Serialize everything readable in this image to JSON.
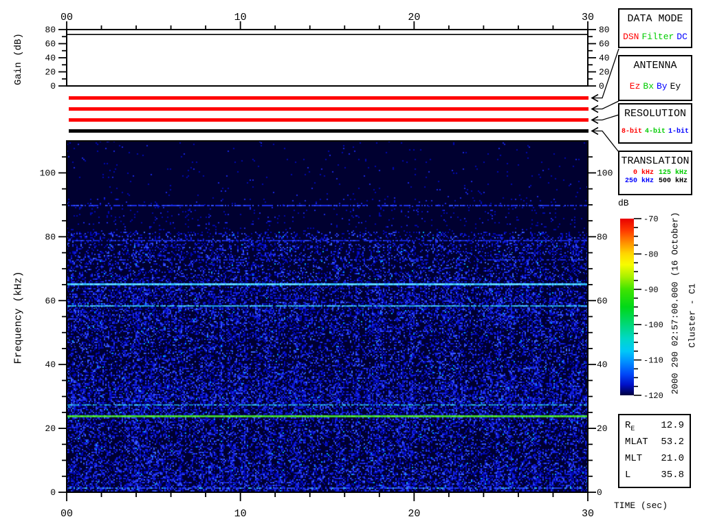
{
  "gain_plot": {
    "ylabel": "Gain (dB)",
    "ytick_labels": [
      "0",
      "20",
      "40",
      "60",
      "80"
    ],
    "ymax": 80,
    "gain_db": 73
  },
  "time_axis_top": {
    "labels": [
      "00",
      "10",
      "20",
      "30"
    ]
  },
  "time_axis_bottom": {
    "labels": [
      "00",
      "10",
      "20",
      "30"
    ],
    "title": "TIME (sec)"
  },
  "spectrogram": {
    "ylabel": "Frequency (kHz)",
    "ytick_labels": [
      "0",
      "20",
      "40",
      "60",
      "80",
      "100"
    ],
    "freq_max_khz": 110
  },
  "status_bars": [
    {
      "name": "data-mode",
      "color": "#ff0000",
      "value": "DSN"
    },
    {
      "name": "antenna",
      "color": "#ff0000",
      "value": "Ez"
    },
    {
      "name": "resolution",
      "color": "#ff0000",
      "value": "8-bit"
    },
    {
      "name": "translation",
      "color": "#000000",
      "value": "500 kHz"
    }
  ],
  "legend_boxes": [
    {
      "title": "DATA MODE",
      "items": [
        {
          "label": "DSN",
          "color": "#ff0000"
        },
        {
          "label": "Filter",
          "color": "#00cc00"
        },
        {
          "label": "DC",
          "color": "#0000ff"
        }
      ]
    },
    {
      "title": "ANTENNA",
      "items": [
        {
          "label": "Ez",
          "color": "#ff0000"
        },
        {
          "label": "Bx",
          "color": "#00cc00"
        },
        {
          "label": "By",
          "color": "#0000ff"
        },
        {
          "label": "Ey",
          "color": "#000000"
        }
      ]
    },
    {
      "title": "RESOLUTION",
      "items": [
        {
          "label": "8-bit",
          "color": "#ff0000"
        },
        {
          "label": "4-bit",
          "color": "#00cc00"
        },
        {
          "label": "1-bit",
          "color": "#0000ff"
        }
      ]
    },
    {
      "title": "TRANSLATION",
      "lines": [
        [
          {
            "label": "0 kHz",
            "color": "#ff0000"
          },
          {
            "label": "125 kHz",
            "color": "#00cc00"
          }
        ],
        [
          {
            "label": "250 kHz",
            "color": "#0000ff"
          },
          {
            "label": "500 kHz",
            "color": "#000000"
          }
        ]
      ]
    }
  ],
  "colorbar": {
    "label": "dB",
    "tick_labels": [
      "-70",
      "-80",
      "-90",
      "-100",
      "-110",
      "-120"
    ]
  },
  "side_annotations": {
    "timestamp": "2000 290 02:57:00.000  (16 October)",
    "spacecraft": "Cluster - C1"
  },
  "ephemeris": {
    "rows": [
      {
        "label": "R",
        "sub": "E",
        "value": "12.9"
      },
      {
        "label": "MLAT",
        "sub": "",
        "value": "53.2"
      },
      {
        "label": "MLT",
        "sub": "",
        "value": "21.0"
      },
      {
        "label": "L",
        "sub": "",
        "value": "35.8"
      }
    ]
  },
  "chart_data": [
    {
      "type": "heatmap",
      "title": "Cluster - C1 WBD spectrogram, 2000 290 02:57:00.000 (16 October)",
      "xlabel": "TIME (sec)",
      "ylabel": "Frequency (kHz)",
      "xlim": [
        0,
        30
      ],
      "ylim": [
        0,
        110
      ],
      "x_ticks": [
        0,
        10,
        20,
        30
      ],
      "x_minor_step_sec": 2,
      "y_ticks": [
        0,
        20,
        40,
        60,
        80,
        100
      ],
      "y_minor_step_khz": 5,
      "colorbar": {
        "label": "dB",
        "range_db": [
          -120,
          -70
        ],
        "ticks_db": [
          -70,
          -80,
          -90,
          -100,
          -110,
          -120
        ],
        "minor_step_db": 2.5
      },
      "background_level_db": {
        "above_80_khz": -119,
        "below_80_khz": -113
      },
      "spectral_lines": [
        {
          "freq_khz": 90,
          "approx_level_db": -112,
          "style": "intermittent blue line"
        },
        {
          "freq_khz": 79,
          "approx_level_db": -113,
          "style": "faint blue line"
        },
        {
          "freq_khz": 65,
          "approx_level_db": -107,
          "style": "continuous cyan line"
        },
        {
          "freq_khz": 58.5,
          "approx_level_db": -108,
          "style": "continuous cyan line"
        },
        {
          "freq_khz": 27.5,
          "approx_level_db": -107,
          "style": "intermittent cyan line"
        },
        {
          "freq_khz": 24,
          "approx_level_db": -96,
          "style": "continuous green line"
        },
        {
          "freq_khz": 1.5,
          "approx_level_db": -110,
          "style": "noisy blue band at bottom edge"
        }
      ],
      "legend_position": "right"
    },
    {
      "type": "line",
      "title": "Receiver gain",
      "ylabel": "Gain (dB)",
      "xlim": [
        0,
        30
      ],
      "ylim": [
        0,
        80
      ],
      "y_ticks": [
        0,
        20,
        40,
        60,
        80
      ],
      "series": [
        {
          "name": "gain",
          "x": [
            0,
            30
          ],
          "values": [
            73,
            73
          ]
        }
      ]
    }
  ]
}
